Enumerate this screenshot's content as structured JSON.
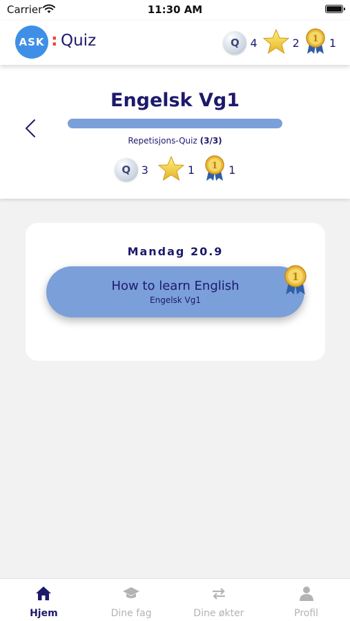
{
  "status_bar": {
    "carrier": "Carrier",
    "time": "11:30 AM"
  },
  "header": {
    "logo_text": "ASK",
    "colon": ":",
    "title": "Quiz",
    "stats": {
      "quiz_count": "4",
      "star_count": "2",
      "medal_count": "1"
    }
  },
  "course": {
    "title": "Engelsk Vg1",
    "progress_fraction": 1.0,
    "quiz_label": "Repetisjons-Quiz",
    "quiz_progress": "(3/3)",
    "stats": {
      "quiz_count": "3",
      "star_count": "1",
      "medal_count": "1"
    }
  },
  "session": {
    "date": "Mandag 20.9",
    "title": "How to learn English",
    "subtitle": "Engelsk Vg1"
  },
  "tabs": [
    {
      "label": "Hjem",
      "icon": "home-icon",
      "active": true
    },
    {
      "label": "Dine fag",
      "icon": "graduation-cap-icon",
      "active": false
    },
    {
      "label": "Dine økter",
      "icon": "repeat-icon",
      "active": false
    },
    {
      "label": "Profil",
      "icon": "user-icon",
      "active": false
    }
  ],
  "colors": {
    "primary_text": "#1d1a6b",
    "accent_blue": "#7a9fd9",
    "logo_blue": "#3f8fe6",
    "logo_colon": "#e9423a",
    "inactive_tab": "#b3b3b3"
  }
}
